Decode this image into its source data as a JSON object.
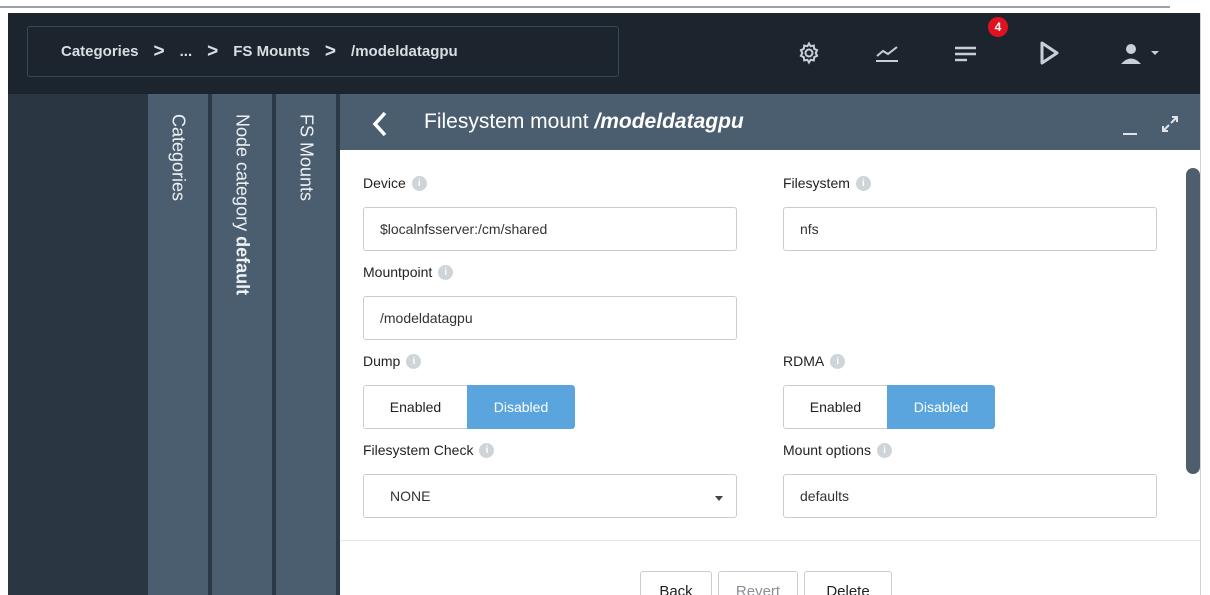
{
  "breadcrumb": {
    "items": [
      "Categories",
      "...",
      "FS Mounts",
      "/modeldatagpu"
    ],
    "separator": ">"
  },
  "header": {
    "notification_count": "4",
    "icons": [
      "settings-icon",
      "chart-icon",
      "list-icon",
      "play-icon",
      "user-icon"
    ]
  },
  "vertical_tabs": {
    "categories": "Categories",
    "node_category_prefix": "Node category ",
    "node_category_name": "default",
    "fs_mounts": "FS Mounts"
  },
  "panel": {
    "title_prefix": "Filesystem mount ",
    "title_name": "/modeldatagpu"
  },
  "form": {
    "device_label": "Device",
    "device_value": "$localnfsserver:/cm/shared",
    "filesystem_label": "Filesystem",
    "filesystem_value": "nfs",
    "mountpoint_label": "Mountpoint",
    "mountpoint_value": "/modeldatagpu",
    "dump_label": "Dump",
    "rdma_label": "RDMA",
    "enabled_label": "Enabled",
    "disabled_label": "Disabled",
    "fscheck_label": "Filesystem Check",
    "fscheck_value": "NONE",
    "mount_options_label": "Mount options",
    "mount_options_value": "defaults"
  },
  "footer": {
    "back": "Back",
    "revert": "Revert",
    "delete": "Delete"
  },
  "colors": {
    "header_bg": "#1c252e",
    "tab_bg": "#4b5e70",
    "accent": "#5aa5dd",
    "badge": "#e0121f"
  }
}
